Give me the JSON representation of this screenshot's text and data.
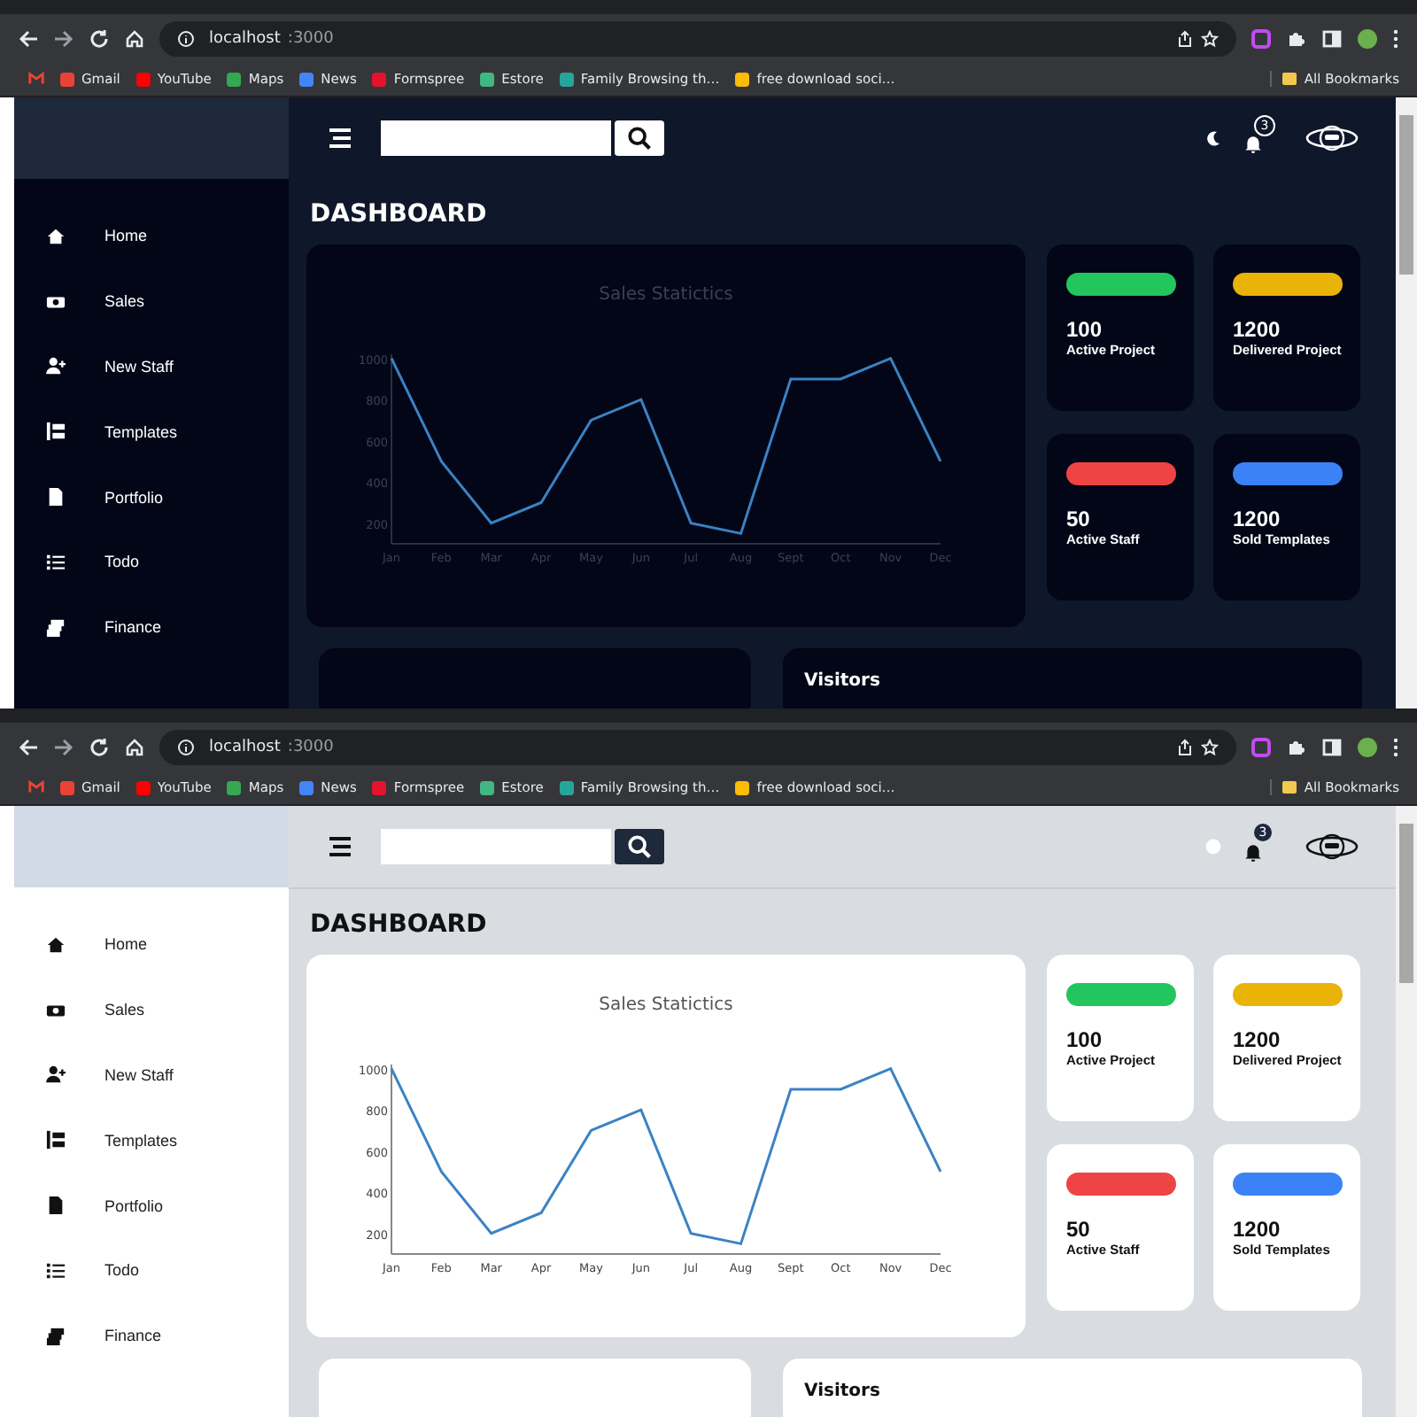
{
  "panels": [
    {
      "kind": "dark",
      "browser": {
        "address_host": "localhost",
        "address_port": ":3000",
        "bookmarks": [
          {
            "label": "Gmail",
            "color": "#ea4335"
          },
          {
            "label": "YouTube",
            "color": "#ff0000"
          },
          {
            "label": "Maps",
            "color": "#34a853"
          },
          {
            "label": "News",
            "color": "#4285f4"
          },
          {
            "label": "Formspree",
            "color": "#e5122e"
          },
          {
            "label": "Estore",
            "color": "#41b883"
          },
          {
            "label": "Family Browsing th…",
            "color": "#26a69a"
          },
          {
            "label": "free download soci…",
            "color": "#fbbc05"
          }
        ],
        "all_bookmarks": "All Bookmarks"
      },
      "sidebar": {
        "items": [
          {
            "kind": "home",
            "label": "Home"
          },
          {
            "kind": "sales",
            "label": "Sales"
          },
          {
            "kind": "staff",
            "label": "New Staff"
          },
          {
            "kind": "templates",
            "label": "Templates"
          },
          {
            "kind": "portfolio",
            "label": "Portfolio"
          },
          {
            "kind": "todo",
            "label": "Todo"
          },
          {
            "kind": "finance",
            "label": "Finance"
          }
        ]
      },
      "topbar": {
        "notification_count": "3"
      },
      "title": "DASHBOARD",
      "chart_data": {
        "type": "line",
        "title": "Sales Statictics",
        "categories": [
          "Jan",
          "Feb",
          "Mar",
          "Apr",
          "May",
          "Jun",
          "Jul",
          "Aug",
          "Sept",
          "Oct",
          "Nov",
          "Dec"
        ],
        "values": [
          1000,
          500,
          200,
          300,
          700,
          800,
          200,
          150,
          900,
          900,
          1000,
          500
        ],
        "ylim": [
          100,
          1020
        ],
        "yticks": [
          200,
          400,
          600,
          800,
          1000
        ]
      },
      "stats": [
        {
          "value": "100",
          "label": "Active Project",
          "color": "#22c55e"
        },
        {
          "value": "1200",
          "label": "Delivered Project",
          "color": "#eab308"
        },
        {
          "value": "50",
          "label": "Active Staff",
          "color": "#ef4444"
        },
        {
          "value": "1200",
          "label": "Sold Templates",
          "color": "#3b82f6"
        }
      ],
      "visitors_title": "Visitors"
    },
    {
      "kind": "light",
      "browser": {
        "address_host": "localhost",
        "address_port": ":3000",
        "bookmarks": [
          {
            "label": "Gmail",
            "color": "#ea4335"
          },
          {
            "label": "YouTube",
            "color": "#ff0000"
          },
          {
            "label": "Maps",
            "color": "#34a853"
          },
          {
            "label": "News",
            "color": "#4285f4"
          },
          {
            "label": "Formspree",
            "color": "#e5122e"
          },
          {
            "label": "Estore",
            "color": "#41b883"
          },
          {
            "label": "Family Browsing th…",
            "color": "#26a69a"
          },
          {
            "label": "free download soci…",
            "color": "#fbbc05"
          }
        ],
        "all_bookmarks": "All Bookmarks"
      },
      "sidebar": {
        "items": [
          {
            "kind": "home",
            "label": "Home"
          },
          {
            "kind": "sales",
            "label": "Sales"
          },
          {
            "kind": "staff",
            "label": "New Staff"
          },
          {
            "kind": "templates",
            "label": "Templates"
          },
          {
            "kind": "portfolio",
            "label": "Portfolio"
          },
          {
            "kind": "todo",
            "label": "Todo"
          },
          {
            "kind": "finance",
            "label": "Finance"
          }
        ]
      },
      "topbar": {
        "notification_count": "3"
      },
      "title": "DASHBOARD",
      "chart_data": {
        "type": "line",
        "title": "Sales Statictics",
        "categories": [
          "Jan",
          "Feb",
          "Mar",
          "Apr",
          "May",
          "Jun",
          "Jul",
          "Aug",
          "Sept",
          "Oct",
          "Nov",
          "Dec"
        ],
        "values": [
          1000,
          500,
          200,
          300,
          700,
          800,
          200,
          150,
          900,
          900,
          1000,
          500
        ],
        "ylim": [
          100,
          1020
        ],
        "yticks": [
          200,
          400,
          600,
          800,
          1000
        ]
      },
      "stats": [
        {
          "value": "100",
          "label": "Active Project",
          "color": "#22c55e"
        },
        {
          "value": "1200",
          "label": "Delivered Project",
          "color": "#eab308"
        },
        {
          "value": "50",
          "label": "Active Staff",
          "color": "#ef4444"
        },
        {
          "value": "1200",
          "label": "Sold Templates",
          "color": "#3b82f6"
        }
      ],
      "visitors_title": "Visitors"
    }
  ]
}
